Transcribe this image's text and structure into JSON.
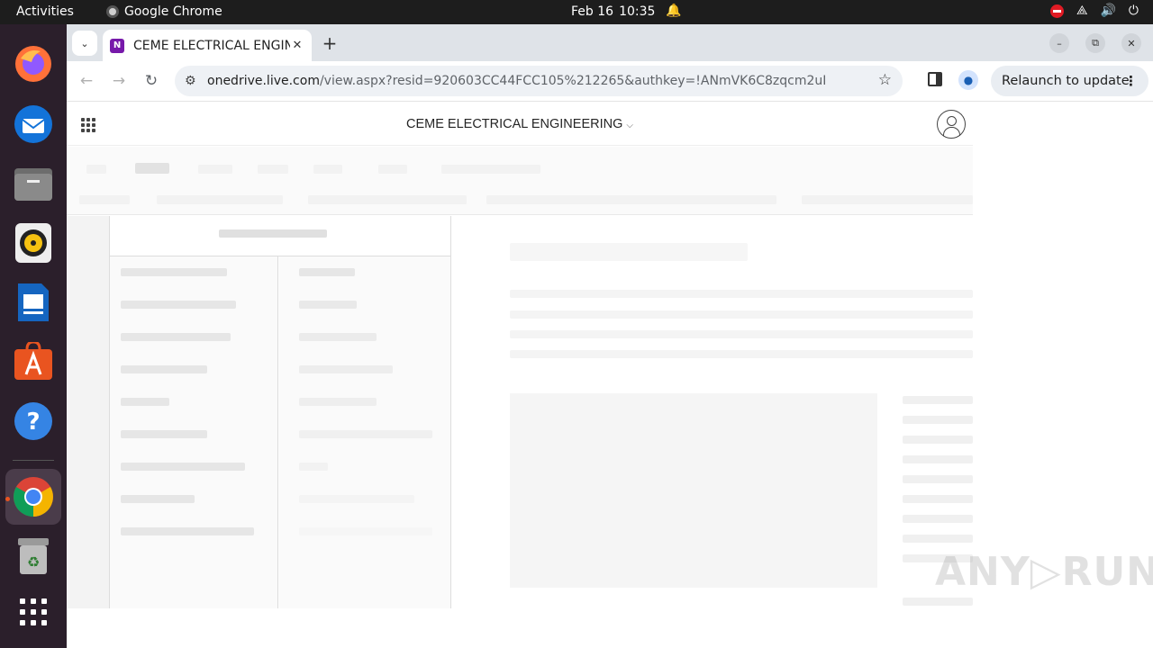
{
  "topbar": {
    "activities": "Activities",
    "app_name": "Google Chrome",
    "date": "Feb 16",
    "time": "10:35"
  },
  "dock": {
    "items": [
      "firefox-icon",
      "thunderbird-icon",
      "files-icon",
      "rhythmbox-icon",
      "libreoffice-writer-icon",
      "app-center-icon",
      "help-icon",
      "chrome-icon",
      "trash-icon",
      "show-apps-icon"
    ],
    "active": "chrome-icon"
  },
  "browser": {
    "tab_title": "CEME ELECTRICAL ENGINEERING",
    "url_host": "onedrive.live.com",
    "url_rest": "/view.aspx?resid=920603CC44FCC105%212265&authkey=!ANmVK6C8zqcm2uI",
    "relaunch_label": "Relaunch to update"
  },
  "onenote": {
    "title": "CEME ELECTRICAL ENGINEERING",
    "title_caret": "⌵"
  },
  "watermark": "ANY▷RUN",
  "colors": {
    "topbar": "#1d1d1d",
    "dock": "#2b1f2b",
    "onenote_brand": "#7719aa",
    "skeleton": "#ececec"
  }
}
